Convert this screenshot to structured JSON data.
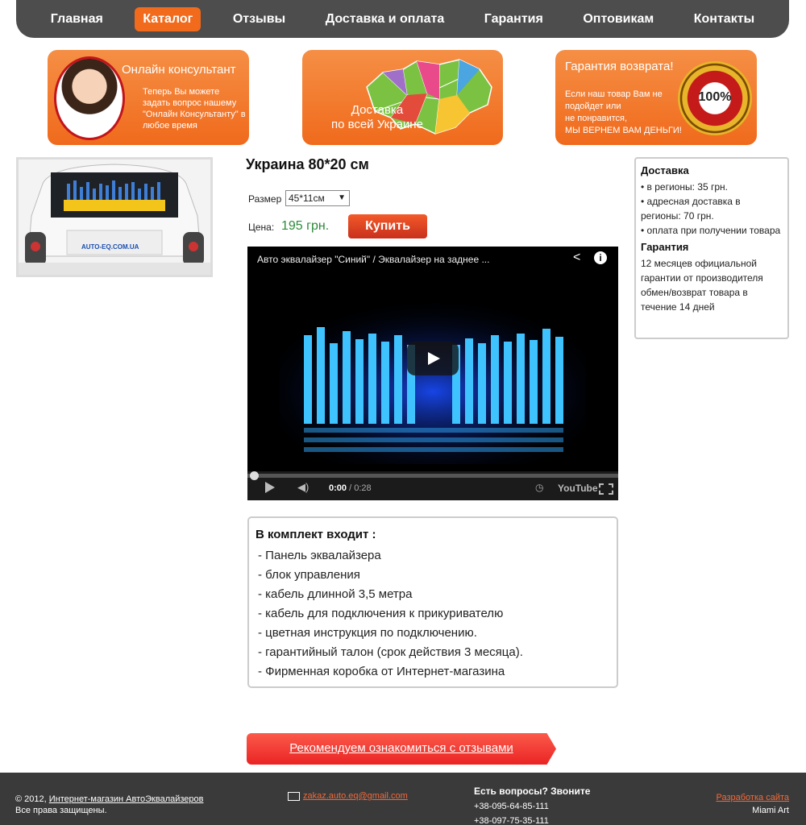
{
  "nav": {
    "items": [
      {
        "label": "Главная"
      },
      {
        "label": "Каталог",
        "active": true
      },
      {
        "label": "Отзывы"
      },
      {
        "label": "Доставка и оплата"
      },
      {
        "label": "Гарантия"
      },
      {
        "label": "Оптовикам"
      },
      {
        "label": "Контакты"
      }
    ]
  },
  "banners": {
    "consultant": {
      "title": "Онлайн консультант",
      "text": "Теперь Вы можете задать вопрос нашему \"Онлайн Консультанту\" в любое время"
    },
    "delivery": {
      "line1": "Доставка",
      "line2": "по всей Украине"
    },
    "guarantee": {
      "title": "Гарантия возврата!",
      "line1": "Если наш товар Вам не",
      "line2": "подойдет или",
      "line3": "не понравится,",
      "line4": "МЫ ВЕРНЕМ ВАМ ДЕНЬГИ!",
      "seal_text": "100%"
    }
  },
  "product": {
    "title": "Украина 80*20 см",
    "size_label": "Размер",
    "size_value": "45*11см",
    "price_label": "Цена:",
    "price": "195 грн.",
    "buy_label": "Купить",
    "image_caption": "AUTO-EQ.COM.UA"
  },
  "video": {
    "title": "Авто эквалайзер \"Синий\" / Эквалайзер на заднее ...",
    "time_current": "0:00",
    "time_total": "/ 0:28",
    "youtube_label": "YouTube"
  },
  "kit": {
    "heading": "В комплект входит :",
    "items": [
      "- Панель эквалайзера",
      "- блок управления",
      "- кабель длинной 3,5 метра",
      "- кабель для подключения к прикуривателю",
      "- цветная инструкция по подключению.",
      "- гарантийный талон (срок действия 3 месяца).",
      "- Фирменная коробка от Интернет-магазина"
    ]
  },
  "sidebar": {
    "delivery_heading": "Доставка",
    "delivery_items": [
      "•   в регионы: 35 грн.",
      "•   адресная доставка в регионы: 70 грн.",
      "•   оплата при получении товара"
    ],
    "guarantee_heading": "Гарантия",
    "guarantee_text": "12 месяцев официальной гарантии от производителя обмен/возврат товара в течение 14 дней"
  },
  "cta": {
    "label": "Рекомендуем ознакомиться с отзывами"
  },
  "footer": {
    "copy_prefix": "© 2012, ",
    "copy_link": "Интернет-магазин АвтоЭквалайзеров",
    "rights": "Все права защищены.",
    "email": "zakaz.auto.eq@gmail.com",
    "phone_heading": "Есть вопросы? Звоните",
    "phone1": "+38-095-64-85-111",
    "phone2": "+38-097-75-35-111",
    "dev_link": "Разработка сайта",
    "dev_name": "Miami Art"
  }
}
